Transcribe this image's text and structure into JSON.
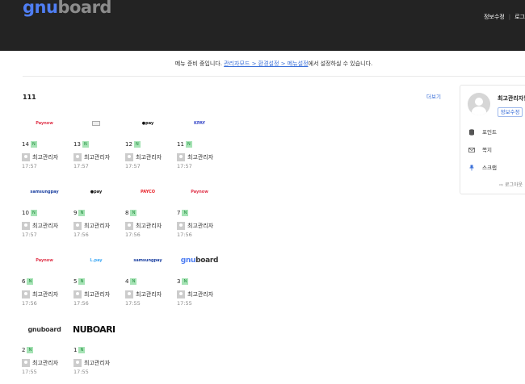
{
  "header": {
    "logo": {
      "part1": "gnu",
      "part2": "board"
    },
    "links": [
      "정보수정",
      "로그"
    ]
  },
  "notice": {
    "prefix": "메뉴 준비 중입니다. ",
    "link": "관리자모드 > 환경설정 > 메뉴설정",
    "suffix": "에서 설정하실 수 있습니다."
  },
  "board": {
    "title": "111",
    "more": "더보기",
    "items": [
      {
        "num": "14",
        "new": "N",
        "author": "최고관리자",
        "time": "17:57",
        "thumb": "Paynow"
      },
      {
        "num": "13",
        "new": "N",
        "author": "최고관리자",
        "time": "17:57",
        "thumb": ""
      },
      {
        "num": "12",
        "new": "N",
        "author": "최고관리자",
        "time": "17:57",
        "thumb": "●pay"
      },
      {
        "num": "11",
        "new": "N",
        "author": "최고관리자",
        "time": "17:57",
        "thumb": "KPAY"
      },
      {
        "num": "10",
        "new": "N",
        "author": "최고관리자",
        "time": "17:57",
        "thumb": "samsungpay"
      },
      {
        "num": "9",
        "new": "N",
        "author": "최고관리자",
        "time": "17:56",
        "thumb": "●pay"
      },
      {
        "num": "8",
        "new": "N",
        "author": "최고관리자",
        "time": "17:56",
        "thumb": "PAYCO"
      },
      {
        "num": "7",
        "new": "N",
        "author": "최고관리자",
        "time": "17:56",
        "thumb": "Paynow"
      },
      {
        "num": "6",
        "new": "N",
        "author": "최고관리자",
        "time": "17:56",
        "thumb": "Paynow"
      },
      {
        "num": "5",
        "new": "N",
        "author": "최고관리자",
        "time": "17:56",
        "thumb": "L.pay"
      },
      {
        "num": "4",
        "new": "N",
        "author": "최고관리자",
        "time": "17:55",
        "thumb": "samsungpay"
      },
      {
        "num": "3",
        "new": "N",
        "author": "최고관리자",
        "time": "17:55",
        "thumb": "gnuboard"
      },
      {
        "num": "2",
        "new": "N",
        "author": "최고관리자",
        "time": "17:55",
        "thumb": "gnuboard"
      },
      {
        "num": "1",
        "new": "N",
        "author": "최고관리자",
        "time": "17:55",
        "thumb": "NUBOARI"
      }
    ]
  },
  "sidebar": {
    "name": "최고관리자님",
    "info_button": "정보수정",
    "items": [
      {
        "label": "포인트",
        "icon": "database-icon"
      },
      {
        "label": "쪽지",
        "icon": "envelope-icon"
      },
      {
        "label": "스크랩",
        "icon": "thumbtack-icon"
      }
    ],
    "logout": "로그아웃"
  },
  "colors": {
    "header_bg": "#232323",
    "logo_blue": "#4f7ef3",
    "link_blue": "#3a6fd8",
    "new_badge": "#a6e3b5"
  }
}
